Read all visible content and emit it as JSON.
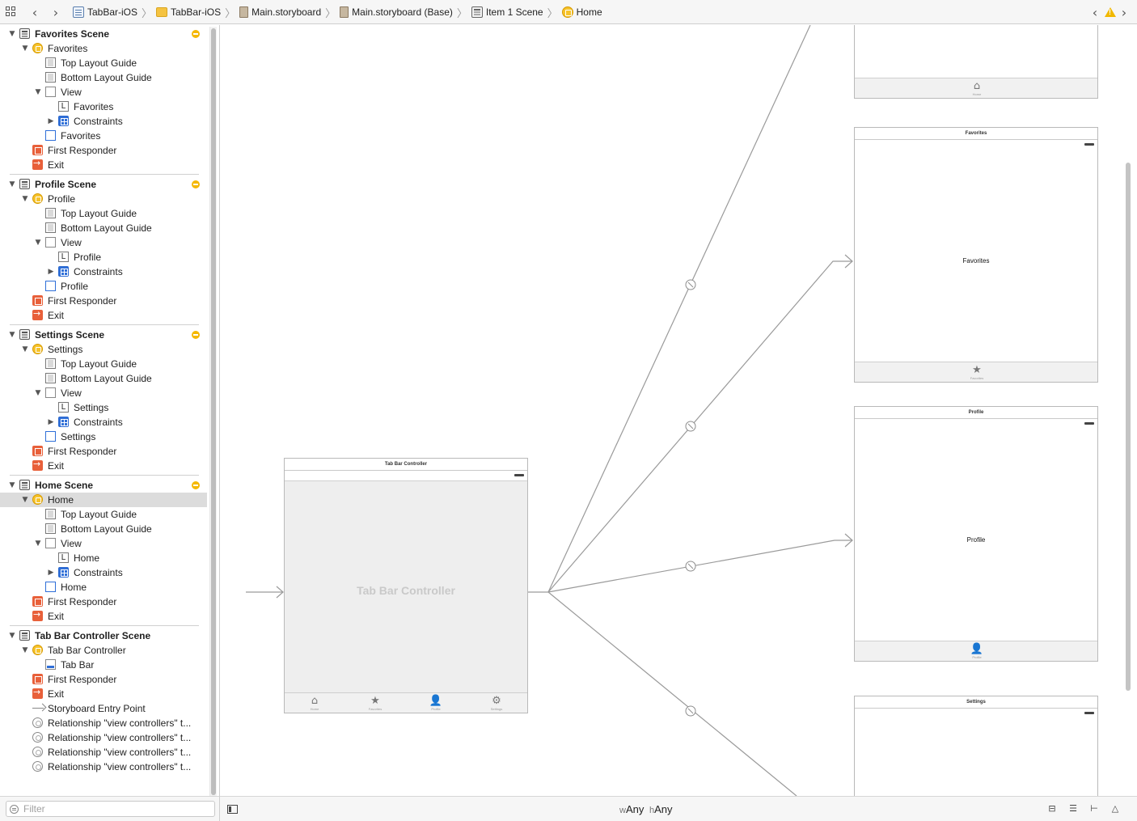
{
  "jumpbar": {
    "breadcrumbs": [
      {
        "label": "TabBar-iOS",
        "icon": "project-file-icon"
      },
      {
        "label": "TabBar-iOS",
        "icon": "folder-icon"
      },
      {
        "label": "Main.storyboard",
        "icon": "storyboard-icon"
      },
      {
        "label": "Main.storyboard (Base)",
        "icon": "storyboard-icon"
      },
      {
        "label": "Item 1 Scene",
        "icon": "scene-icon"
      },
      {
        "label": "Home",
        "icon": "view-controller-icon"
      }
    ],
    "warning_color": "#f1b800"
  },
  "outline": {
    "scenes": [
      {
        "name": "Favorites Scene",
        "items": {
          "vc": "Favorites",
          "top_guide": "Top Layout Guide",
          "bottom_guide": "Bottom Layout Guide",
          "view": "View",
          "label": "Favorites",
          "label_icon_glyph": "L",
          "constraints": "Constraints",
          "tab_item": "Favorites",
          "responder": "First Responder",
          "exit": "Exit"
        }
      },
      {
        "name": "Profile Scene",
        "items": {
          "vc": "Profile",
          "top_guide": "Top Layout Guide",
          "bottom_guide": "Bottom Layout Guide",
          "view": "View",
          "label": "Profile",
          "label_icon_glyph": "L",
          "constraints": "Constraints",
          "tab_item": "Profile",
          "responder": "First Responder",
          "exit": "Exit"
        }
      },
      {
        "name": "Settings Scene",
        "items": {
          "vc": "Settings",
          "top_guide": "Top Layout Guide",
          "bottom_guide": "Bottom Layout Guide",
          "view": "View",
          "label": "Settings",
          "label_icon_glyph": "L",
          "constraints": "Constraints",
          "tab_item": "Settings",
          "responder": "First Responder",
          "exit": "Exit"
        }
      },
      {
        "name": "Home Scene",
        "items": {
          "vc": "Home",
          "top_guide": "Top Layout Guide",
          "bottom_guide": "Bottom Layout Guide",
          "view": "View",
          "label": "Home",
          "label_icon_glyph": "L",
          "constraints": "Constraints",
          "tab_item": "Home",
          "responder": "First Responder",
          "exit": "Exit"
        }
      }
    ],
    "tabbar_scene": {
      "name": "Tab Bar Controller Scene",
      "controller": "Tab Bar Controller",
      "tab_bar": "Tab Bar",
      "responder": "First Responder",
      "exit": "Exit",
      "entry_point": "Storyboard Entry Point",
      "relationships": [
        "Relationship \"view controllers\" t...",
        "Relationship \"view controllers\" t...",
        "Relationship \"view controllers\" t...",
        "Relationship \"view controllers\" t..."
      ]
    },
    "selected": "Home",
    "filter_placeholder": "Filter"
  },
  "canvas": {
    "tab_bar_controller": {
      "title": "Tab Bar Controller",
      "watermark": "Tab Bar Controller",
      "tabs": [
        {
          "label": "Home",
          "icon": "house-icon",
          "glyph": "⌂"
        },
        {
          "label": "Favorites",
          "icon": "star-icon",
          "glyph": "★"
        },
        {
          "label": "Profile",
          "icon": "person-icon",
          "glyph": "👤"
        },
        {
          "label": "Settings",
          "icon": "gear-icon",
          "glyph": "⚙"
        }
      ]
    },
    "home_scene": {
      "tab_label": "Home",
      "tab_glyph": "⌂"
    },
    "favorites_scene": {
      "title": "Favorites",
      "center_label": "Favorites",
      "tab_label": "Favorites",
      "tab_glyph": "★"
    },
    "profile_scene": {
      "title": "Profile",
      "center_label": "Profile",
      "tab_label": "Profile",
      "tab_glyph": "👤"
    },
    "settings_scene": {
      "title": "Settings"
    }
  },
  "bottombar": {
    "width_prefix": "w",
    "width_class": "Any",
    "height_prefix": "h",
    "height_class": "Any",
    "buttons": [
      {
        "name": "stack-view-button",
        "glyph": "⊟"
      },
      {
        "name": "align-button",
        "glyph": "☰"
      },
      {
        "name": "pin-button",
        "glyph": "⊢"
      },
      {
        "name": "resolve-autolayout-button",
        "glyph": "△"
      }
    ]
  }
}
